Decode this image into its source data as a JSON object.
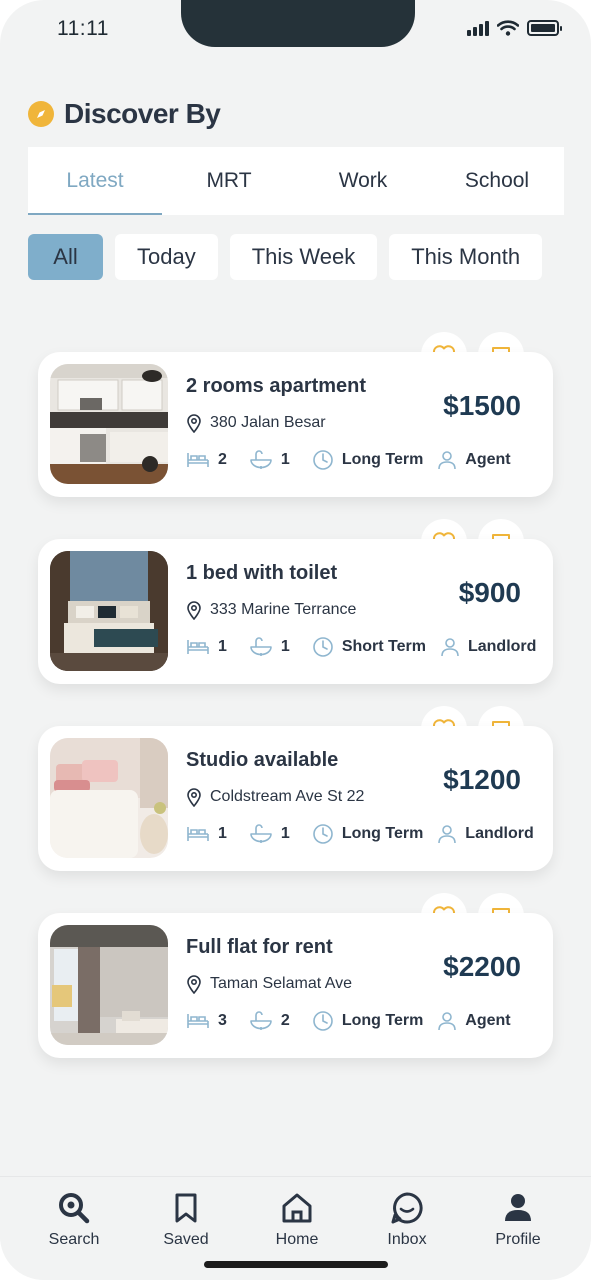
{
  "status": {
    "time": "11:11"
  },
  "header": {
    "title": "Discover By"
  },
  "tabs": [
    {
      "label": "Latest",
      "active": true
    },
    {
      "label": "MRT",
      "active": false
    },
    {
      "label": "Work",
      "active": false
    },
    {
      "label": "School",
      "active": false
    }
  ],
  "filters": [
    {
      "label": "All",
      "active": true
    },
    {
      "label": "Today",
      "active": false
    },
    {
      "label": "This Week",
      "active": false
    },
    {
      "label": "This Month",
      "active": false
    }
  ],
  "listings": [
    {
      "title": "2 rooms apartment",
      "address": "380 Jalan Besar",
      "price": "$1500",
      "beds": "2",
      "baths": "1",
      "term": "Long Term",
      "poster": "Agent",
      "photo": "kitchen"
    },
    {
      "title": "1 bed with toilet",
      "address": "333 Marine Terrance",
      "price": "$900",
      "beds": "1",
      "baths": "1",
      "term": "Short Term",
      "poster": "Landlord",
      "photo": "bedroom-dark"
    },
    {
      "title": "Studio available",
      "address": "Coldstream Ave St 22",
      "price": "$1200",
      "beds": "1",
      "baths": "1",
      "term": "Long Term",
      "poster": "Landlord",
      "photo": "bedroom-pink"
    },
    {
      "title": "Full flat for rent",
      "address": "Taman Selamat Ave",
      "price": "$2200",
      "beds": "3",
      "baths": "2",
      "term": "Long Term",
      "poster": "Agent",
      "photo": "living-room"
    }
  ],
  "nav": [
    {
      "label": "Search",
      "icon": "search-icon"
    },
    {
      "label": "Saved",
      "icon": "bookmark-icon"
    },
    {
      "label": "Home",
      "icon": "home-icon"
    },
    {
      "label": "Inbox",
      "icon": "chat-icon"
    },
    {
      "label": "Profile",
      "icon": "profile-icon"
    }
  ],
  "colors": {
    "accent": "#7faecb",
    "heart": "#f0b53a",
    "text": "#2b3544",
    "price": "#1f3a52"
  }
}
